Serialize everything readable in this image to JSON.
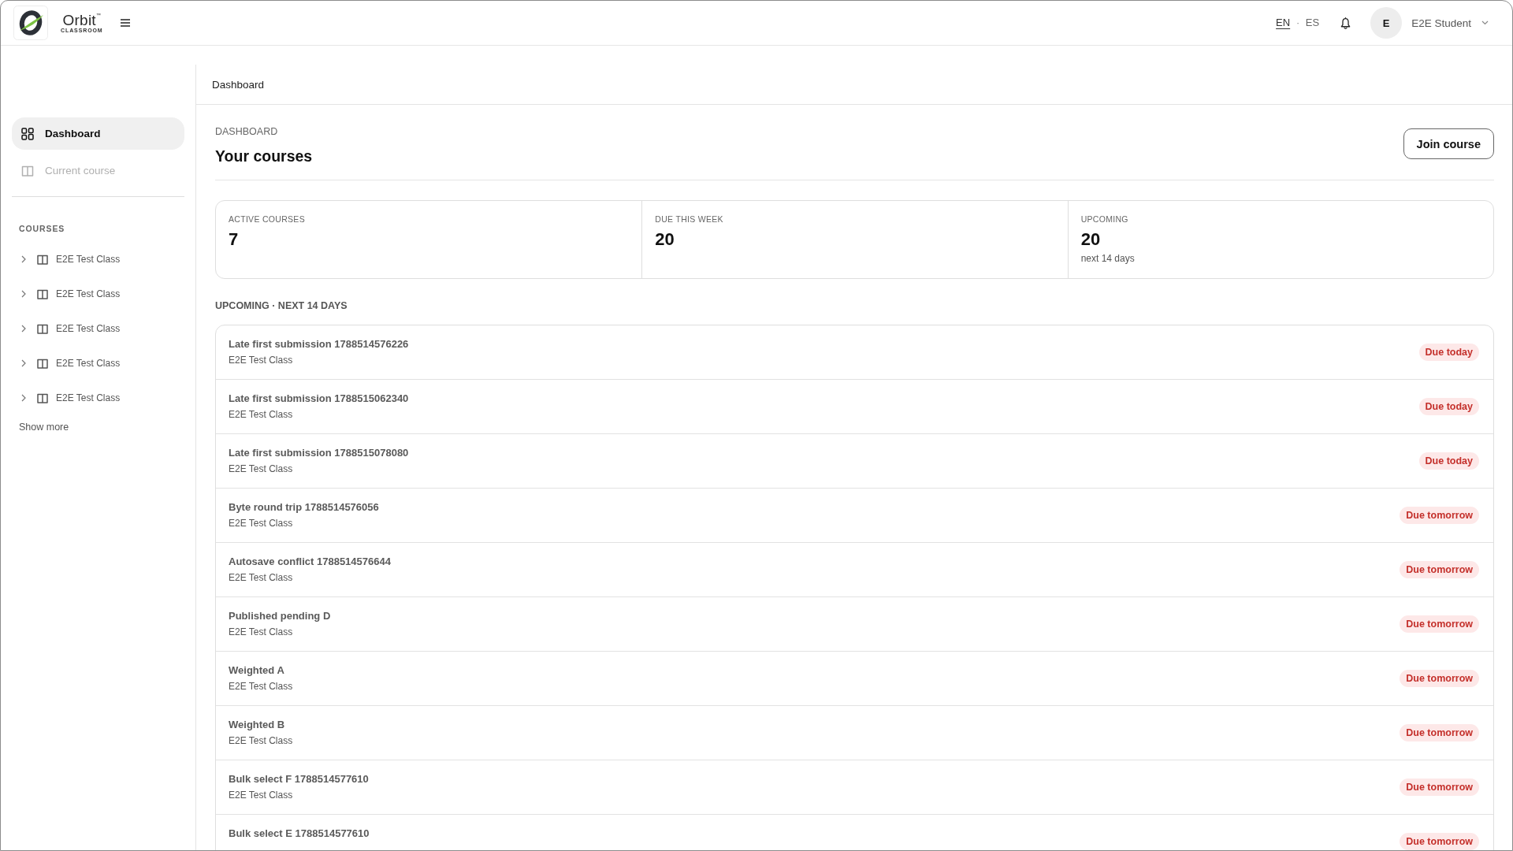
{
  "header": {
    "brand": {
      "name": "Orbit$^{™}$",
      "tagline": "CLASSROOM"
    },
    "languages": [
      {
        "label": "EN",
        "selected": true
      },
      {
        "label": "ES",
        "selected": false
      }
    ],
    "language_separator": "·",
    "user": {
      "initial": "E",
      "name": "E2E Student"
    }
  },
  "sidebar": {
    "nav": [
      {
        "label": "Dashboard",
        "kind": "dashboard",
        "selected": true,
        "disabled": false
      },
      {
        "label": "Current course",
        "kind": "course",
        "selected": false,
        "disabled": true
      }
    ],
    "courses_heading": "COURSES",
    "courses": [
      {
        "label": "E2E Test Class",
        "expanded": false
      },
      {
        "label": "E2E Test Class",
        "expanded": false
      },
      {
        "label": "E2E Test Class",
        "expanded": false
      },
      {
        "label": "E2E Test Class",
        "expanded": false
      },
      {
        "label": "E2E Test Class",
        "expanded": false
      }
    ],
    "show_more": "Show more"
  },
  "breadcrumb": "Dashboard",
  "page": {
    "eyebrow": "DASHBOARD",
    "title": "Your courses",
    "join_button": "Join course"
  },
  "stats": [
    {
      "label": "ACTIVE COURSES",
      "value": "7"
    },
    {
      "label": "DUE THIS WEEK",
      "value": "20"
    },
    {
      "label": "UPCOMING",
      "value": "20",
      "note": "next 14 days"
    }
  ],
  "upcoming": {
    "heading": "UPCOMING · NEXT 14 DAYS",
    "items": [
      {
        "title": "Late first submission 1788514576226",
        "course": "E2E Test Class",
        "due": "Due today"
      },
      {
        "title": "Late first submission 1788515062340",
        "course": "E2E Test Class",
        "due": "Due today"
      },
      {
        "title": "Late first submission 1788515078080",
        "course": "E2E Test Class",
        "due": "Due today"
      },
      {
        "title": "Byte round trip 1788514576056",
        "course": "E2E Test Class",
        "due": "Due tomorrow"
      },
      {
        "title": "Autosave conflict 1788514576644",
        "course": "E2E Test Class",
        "due": "Due tomorrow"
      },
      {
        "title": "Published pending D",
        "course": "E2E Test Class",
        "due": "Due tomorrow"
      },
      {
        "title": "Weighted A",
        "course": "E2E Test Class",
        "due": "Due tomorrow"
      },
      {
        "title": "Weighted B",
        "course": "E2E Test Class",
        "due": "Due tomorrow"
      },
      {
        "title": "Bulk select F 1788514577610",
        "course": "E2E Test Class",
        "due": "Due tomorrow"
      },
      {
        "title": "Bulk select E 1788514577610",
        "due": "Due tomorrow"
      }
    ]
  }
}
